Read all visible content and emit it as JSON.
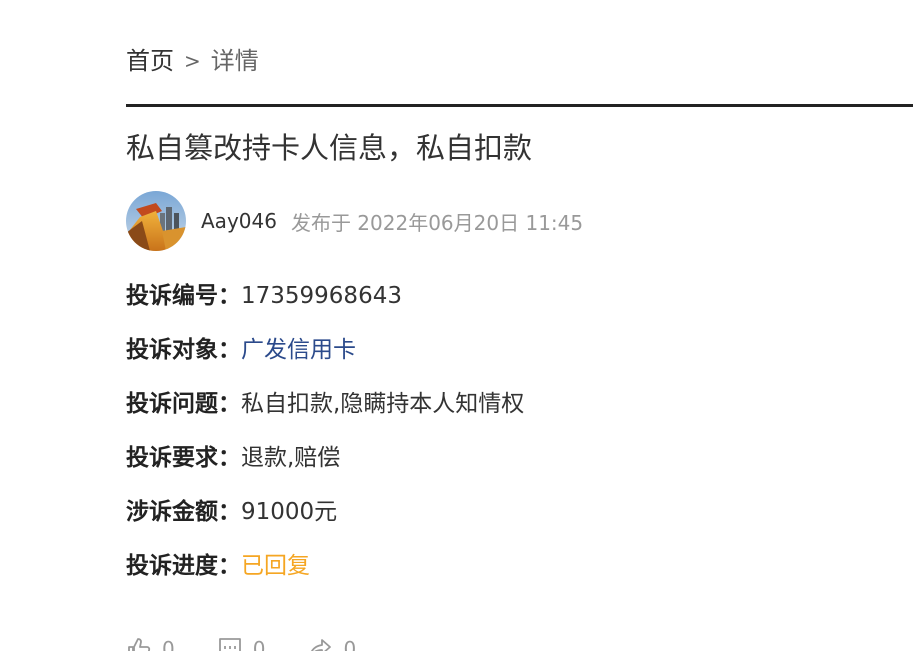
{
  "breadcrumb": {
    "home": "首页",
    "separator": ">",
    "current": "详情"
  },
  "complaint": {
    "title": "私自篡改持卡人信息，私自扣款",
    "author": "Aay046",
    "published": "发布于 2022年06月20日 11:45",
    "fields": [
      {
        "label": "投诉编号：",
        "value": "17359968643"
      },
      {
        "label": "投诉对象：",
        "value": "广发信用卡"
      },
      {
        "label": "投诉问题：",
        "value": "私自扣款,隐瞒持本人知情权"
      },
      {
        "label": "投诉要求：",
        "value": "退款,赔偿"
      },
      {
        "label": "涉诉金额：",
        "value": "91000元"
      },
      {
        "label": "投诉进度：",
        "value": "已回复"
      }
    ]
  },
  "actions": {
    "like_count": "0",
    "comment_count": "0",
    "share_count": "0"
  },
  "colors": {
    "link": "#2b4a8b",
    "status": "#f5a623",
    "muted": "#999999",
    "divider": "#222222"
  },
  "icons": [
    "avatar-image",
    "thumbs-up-icon",
    "comment-icon",
    "share-icon"
  ]
}
